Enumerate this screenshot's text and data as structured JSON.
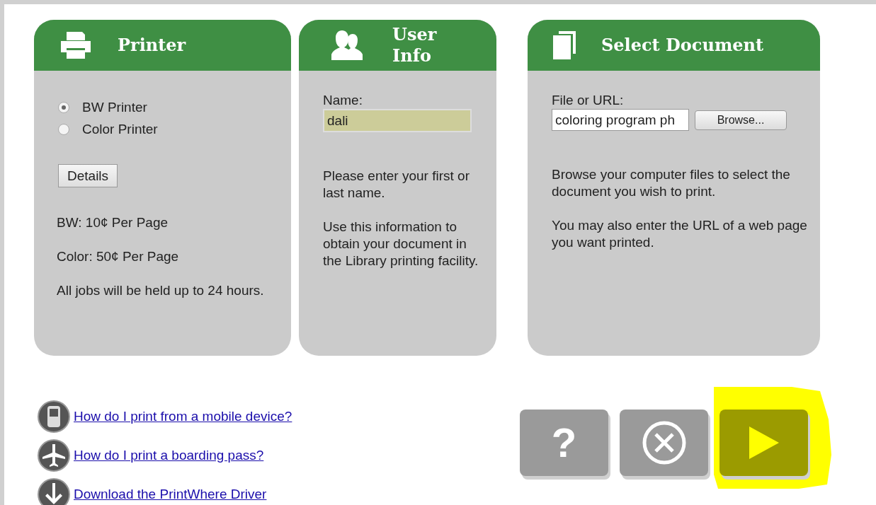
{
  "panels": [
    {
      "kind": "printer",
      "title": "Printer",
      "options": [
        {
          "label": "BW Printer",
          "selected": true
        },
        {
          "label": "Color Printer",
          "selected": false
        }
      ],
      "button": "Details",
      "notes": [
        "BW: 10¢ Per Page",
        "Color: 50¢ Per Page",
        "All jobs will be held up to 24 hours."
      ]
    },
    {
      "kind": "user",
      "title": "User Info",
      "field_label": "Name:",
      "field_value": "dali",
      "notes": [
        "Please enter your first or last name.",
        "Use this information to obtain your document in the Library printing facility."
      ]
    },
    {
      "kind": "document",
      "title": "Select Document",
      "field_label": "File or URL:",
      "field_value": "coloring program ph",
      "button": "Browse...",
      "notes": [
        "Browse your computer files to select the document you wish to print.",
        "You may also enter the URL of a web page you want printed."
      ]
    }
  ],
  "links": [
    {
      "kind": "mobile",
      "label": "How do I print from a mobile device?"
    },
    {
      "kind": "plane",
      "label": "How do I print a boarding pass?"
    },
    {
      "kind": "download",
      "label": "Download the PrintWhere Driver"
    }
  ],
  "actions": [
    {
      "kind": "help",
      "label": "?",
      "highlighted": false
    },
    {
      "kind": "cancel",
      "highlighted": false
    },
    {
      "kind": "next",
      "highlighted": true
    }
  ]
}
